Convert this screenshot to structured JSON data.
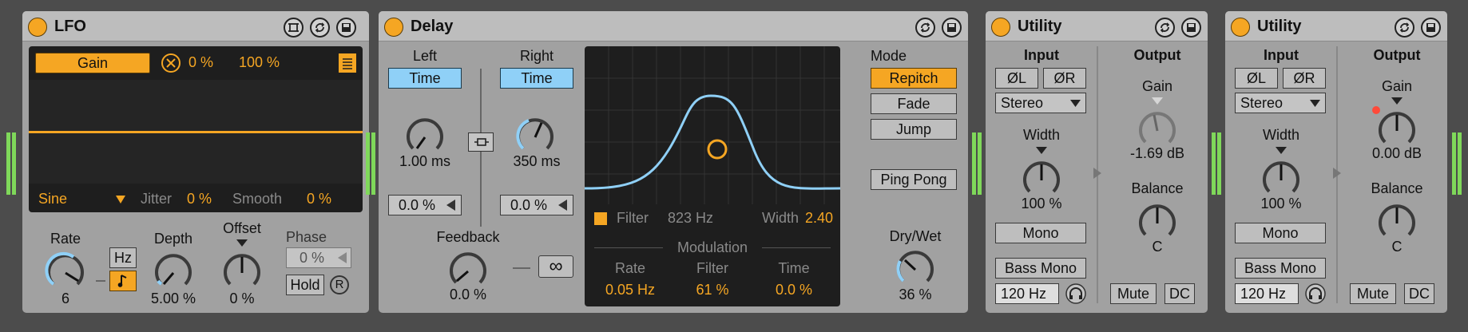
{
  "lfo": {
    "title": "LFO",
    "target_label": "Gain",
    "min_value": "0 %",
    "max_value": "100 %",
    "waveform": "Sine",
    "jitter_label": "Jitter",
    "jitter_value": "0 %",
    "smooth_label": "Smooth",
    "smooth_value": "0 %",
    "rate_label": "Rate",
    "rate_value": "6",
    "rate_mode": "Hz",
    "depth_label": "Depth",
    "depth_value": "5.00 %",
    "offset_label": "Offset",
    "offset_value": "0 %",
    "phase_label": "Phase",
    "phase_value": "0 %",
    "hold_label": "Hold",
    "retrigger_label": "R"
  },
  "delay": {
    "title": "Delay",
    "left_label": "Left",
    "right_label": "Right",
    "left_time_label": "Time",
    "right_time_label": "Time",
    "left_time_value": "1.00 ms",
    "right_time_value": "350 ms",
    "left_offset": "0.0 %",
    "right_offset": "0.0 %",
    "feedback_label": "Feedback",
    "feedback_value": "0.0 %",
    "freeze_label": "∞",
    "filter_label": "Filter",
    "filter_freq": "823 Hz",
    "width_label": "Width",
    "width_value": "2.40",
    "modulation_label": "Modulation",
    "mod_rate_label": "Rate",
    "mod_rate_value": "0.05 Hz",
    "mod_filter_label": "Filter",
    "mod_filter_value": "61 %",
    "mod_time_label": "Time",
    "mod_time_value": "0.0 %",
    "mode_label": "Mode",
    "modes": [
      "Repitch",
      "Fade",
      "Jump"
    ],
    "ping_pong_label": "Ping Pong",
    "drywet_label": "Dry/Wet",
    "drywet_value": "36 %"
  },
  "utility1": {
    "title": "Utility",
    "input_label": "Input",
    "output_label": "Output",
    "phase_l": "ØL",
    "phase_r": "ØR",
    "channel_mode": "Stereo",
    "width_label": "Width",
    "width_value": "100 %",
    "mono_label": "Mono",
    "bass_mono_label": "Bass Mono",
    "bass_freq": "120 Hz",
    "gain_label": "Gain",
    "gain_value": "-1.69 dB",
    "balance_label": "Balance",
    "balance_value": "C",
    "mute_label": "Mute",
    "dc_label": "DC"
  },
  "utility2": {
    "title": "Utility",
    "input_label": "Input",
    "output_label": "Output",
    "phase_l": "ØL",
    "phase_r": "ØR",
    "channel_mode": "Stereo",
    "width_label": "Width",
    "width_value": "100 %",
    "mono_label": "Mono",
    "bass_mono_label": "Bass Mono",
    "bass_freq": "120 Hz",
    "gain_label": "Gain",
    "gain_value": "0.00 dB",
    "balance_label": "Balance",
    "balance_value": "C",
    "mute_label": "Mute",
    "dc_label": "DC"
  },
  "colors": {
    "accent": "#f5a623",
    "blue": "#8fd0f7",
    "panel": "#a1a1a1",
    "display": "#1e1e1e"
  }
}
